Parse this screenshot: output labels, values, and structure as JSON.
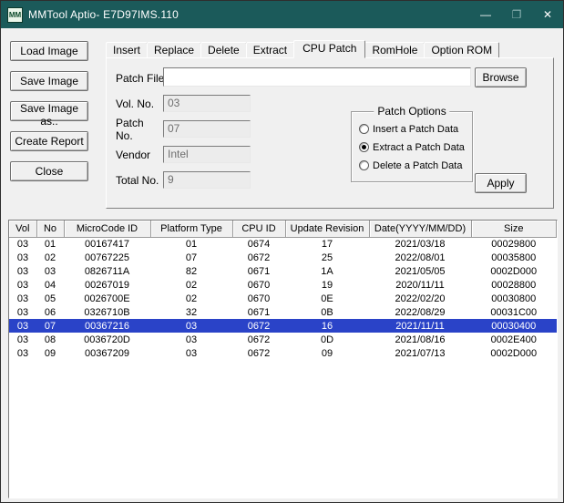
{
  "titlebar": {
    "icon": "MM",
    "title": "MMTool Aptio- E7D97IMS.110",
    "minimize_glyph": "—",
    "maximize_glyph": "❐",
    "close_glyph": "✕"
  },
  "sidebar": {
    "buttons": [
      "Load Image",
      "Save Image",
      "Save Image as..",
      "Create Report",
      "Close"
    ]
  },
  "tabs": [
    "Insert",
    "Replace",
    "Delete",
    "Extract",
    "CPU Patch",
    "RomHole",
    "Option ROM"
  ],
  "active_tab": "CPU Patch",
  "panel": {
    "patch_file_label": "Patch File",
    "patch_file_value": "",
    "browse_label": "Browse",
    "fields": [
      {
        "label": "Vol. No.",
        "value": "03"
      },
      {
        "label": "Patch No.",
        "value": "07"
      },
      {
        "label": "Vendor",
        "value": "Intel"
      },
      {
        "label": "Total No.",
        "value": "9"
      }
    ],
    "patch_options": {
      "title": "Patch Options",
      "options": [
        {
          "label": "Insert a Patch Data",
          "selected": false
        },
        {
          "label": "Extract a Patch Data",
          "selected": true
        },
        {
          "label": "Delete a Patch Data",
          "selected": false
        }
      ]
    },
    "apply_label": "Apply"
  },
  "table": {
    "columns": [
      "Vol",
      "No",
      "MicroCode ID",
      "Platform Type",
      "CPU ID",
      "Update Revision",
      "Date(YYYY/MM/DD)",
      "Size"
    ],
    "rows": [
      [
        "03",
        "01",
        "00167417",
        "01",
        "0674",
        "17",
        "2021/03/18",
        "00029800"
      ],
      [
        "03",
        "02",
        "00767225",
        "07",
        "0672",
        "25",
        "2022/08/01",
        "00035800"
      ],
      [
        "03",
        "03",
        "0826711A",
        "82",
        "0671",
        "1A",
        "2021/05/05",
        "0002D000"
      ],
      [
        "03",
        "04",
        "00267019",
        "02",
        "0670",
        "19",
        "2020/11/11",
        "00028800"
      ],
      [
        "03",
        "05",
        "0026700E",
        "02",
        "0670",
        "0E",
        "2022/02/20",
        "00030800"
      ],
      [
        "03",
        "06",
        "0326710B",
        "32",
        "0671",
        "0B",
        "2022/08/29",
        "00031C00"
      ],
      [
        "03",
        "07",
        "00367216",
        "03",
        "0672",
        "16",
        "2021/11/11",
        "00030400"
      ],
      [
        "03",
        "08",
        "0036720D",
        "03",
        "0672",
        "0D",
        "2021/08/16",
        "0002E400"
      ],
      [
        "03",
        "09",
        "00367209",
        "03",
        "0672",
        "09",
        "2021/07/13",
        "0002D000"
      ]
    ],
    "selected_row_index": 6
  },
  "colors": {
    "titlebar_teal": "#1b5a5a",
    "selection_blue": "#2a43c8",
    "dialog_gray": "#f0f0f0"
  }
}
